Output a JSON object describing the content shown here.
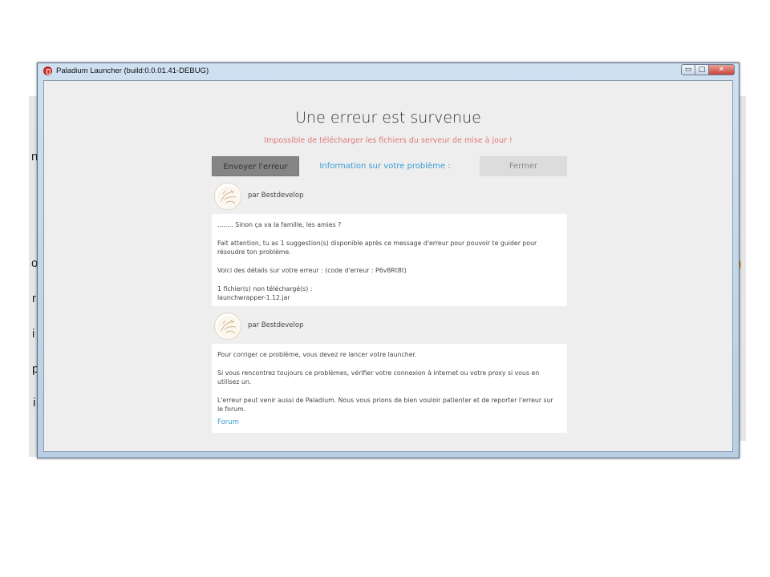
{
  "background": {
    "chars": [
      "n",
      "o",
      "r",
      "i",
      "p",
      "i"
    ]
  },
  "window": {
    "title": "Paladium Launcher (build:0.0.01.41-DEBUG)",
    "controls": {
      "minimize": "▭",
      "maximize": "□",
      "close": "✕"
    }
  },
  "error": {
    "title": "Une erreur est survenue",
    "subtitle": "Impossible de télécharger les fichiers du serveur de mise à jour !"
  },
  "actions": {
    "send_label": "Envoyer l'erreur",
    "info_label": "Information sur votre problème :",
    "close_label": "Fermer"
  },
  "messages": [
    {
      "author": "par Bestdevelop",
      "lines": [
        "........ Sinon ça va la famille, les amies ?",
        "Fait attention, tu as 1 suggestion(s) disponible après ce message d'erreur pour pouvoir te guider pour résoudre ton problème.",
        "Voici des détails sur votre erreur : (code d'erreur : P6v8Rt8t)",
        "1 fichier(s) non téléchargé(s) :",
        "launchwrapper-1.12.jar"
      ]
    },
    {
      "author": "par Bestdevelop",
      "lines": [
        "Pour corriger ce problème, vous devez re lancer votre launcher.",
        "Si vous rencontrez toujours ce problèmes, vérifier votre connexion à internet ou votre proxy si vous en utilisez un.",
        "L'erreur peut venir aussi de Paladium. Nous vous prions de bien vouloir patienter et de reporter l'erreur sur le forum."
      ],
      "link": "Forum"
    }
  ],
  "colors": {
    "subtitle": "#e07a7a",
    "link": "#3a9bd5",
    "send_button": "#858585",
    "close_button": "#dcdcdc"
  }
}
